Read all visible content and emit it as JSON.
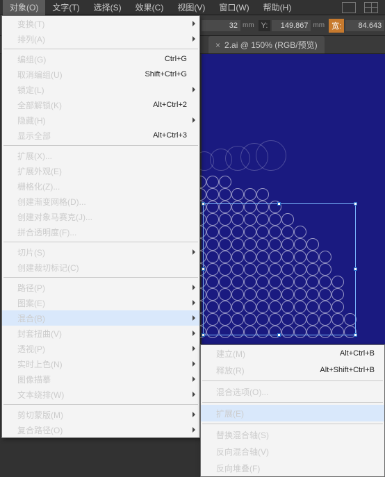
{
  "menubar": {
    "items": [
      "对象(O)",
      "文字(T)",
      "选择(S)",
      "效果(C)",
      "视图(V)",
      "窗口(W)",
      "帮助(H)"
    ]
  },
  "toolbar": {
    "x_suffix": "32",
    "y_label": "Y:",
    "y_value": "149.867",
    "w_label": "宽:",
    "w_value": "84.643",
    "unit": "mm"
  },
  "tab": {
    "close": "×",
    "title": "2.ai @ 150% (RGB/预览)"
  },
  "menu": [
    {
      "t": "item",
      "label": "变换(T)",
      "sub": true
    },
    {
      "t": "item",
      "label": "排列(A)",
      "sub": true
    },
    {
      "t": "sep"
    },
    {
      "t": "item",
      "label": "编组(G)",
      "shortcut": "Ctrl+G"
    },
    {
      "t": "item",
      "label": "取消编组(U)",
      "shortcut": "Shift+Ctrl+G"
    },
    {
      "t": "item",
      "label": "锁定(L)",
      "sub": true
    },
    {
      "t": "item",
      "label": "全部解锁(K)",
      "shortcut": "Alt+Ctrl+2"
    },
    {
      "t": "item",
      "label": "隐藏(H)",
      "sub": true
    },
    {
      "t": "item",
      "label": "显示全部",
      "shortcut": "Alt+Ctrl+3",
      "disabled": true
    },
    {
      "t": "sep"
    },
    {
      "t": "item",
      "label": "扩展(X)..."
    },
    {
      "t": "item",
      "label": "扩展外观(E)",
      "disabled": true
    },
    {
      "t": "item",
      "label": "栅格化(Z)..."
    },
    {
      "t": "item",
      "label": "创建渐变网格(D)...",
      "disabled": true
    },
    {
      "t": "item",
      "label": "创建对象马赛克(J)...",
      "disabled": true
    },
    {
      "t": "item",
      "label": "拼合透明度(F)..."
    },
    {
      "t": "sep"
    },
    {
      "t": "item",
      "label": "切片(S)",
      "sub": true
    },
    {
      "t": "item",
      "label": "创建裁切标记(C)"
    },
    {
      "t": "sep"
    },
    {
      "t": "item",
      "label": "路径(P)",
      "sub": true
    },
    {
      "t": "item",
      "label": "图案(E)",
      "sub": true
    },
    {
      "t": "item",
      "label": "混合(B)",
      "sub": true,
      "hl": true
    },
    {
      "t": "item",
      "label": "封套扭曲(V)",
      "sub": true
    },
    {
      "t": "item",
      "label": "透视(P)",
      "sub": true
    },
    {
      "t": "item",
      "label": "实时上色(N)",
      "sub": true
    },
    {
      "t": "item",
      "label": "图像描摹",
      "sub": true
    },
    {
      "t": "item",
      "label": "文本绕排(W)",
      "sub": true
    },
    {
      "t": "sep"
    },
    {
      "t": "item",
      "label": "剪切蒙版(M)",
      "sub": true
    },
    {
      "t": "item",
      "label": "复合路径(O)",
      "sub": true
    }
  ],
  "submenu": [
    {
      "t": "item",
      "label": "建立(M)",
      "shortcut": "Alt+Ctrl+B"
    },
    {
      "t": "item",
      "label": "释放(R)",
      "shortcut": "Alt+Shift+Ctrl+B"
    },
    {
      "t": "sep"
    },
    {
      "t": "item",
      "label": "混合选项(O)..."
    },
    {
      "t": "sep"
    },
    {
      "t": "item",
      "label": "扩展(E)",
      "hl": true
    },
    {
      "t": "sep"
    },
    {
      "t": "item",
      "label": "替换混合轴(S)",
      "disabled": true
    },
    {
      "t": "item",
      "label": "反向混合轴(V)"
    },
    {
      "t": "item",
      "label": "反向堆叠(F)"
    }
  ]
}
